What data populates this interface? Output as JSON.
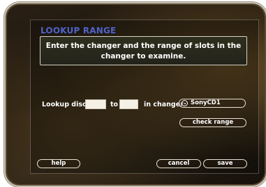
{
  "dialog": {
    "title": "LOOKUP RANGE",
    "message": "Enter the changer and the range of slots in the changer to examine."
  },
  "form": {
    "lookup_label": "Lookup discs",
    "from_value": "",
    "to_label": "to",
    "to_value": "",
    "changer_label": "in changer",
    "changer_value": "SonyCD1",
    "check_range_label": "check range"
  },
  "footer": {
    "help_label": "help",
    "cancel_label": "cancel",
    "save_label": "save"
  }
}
